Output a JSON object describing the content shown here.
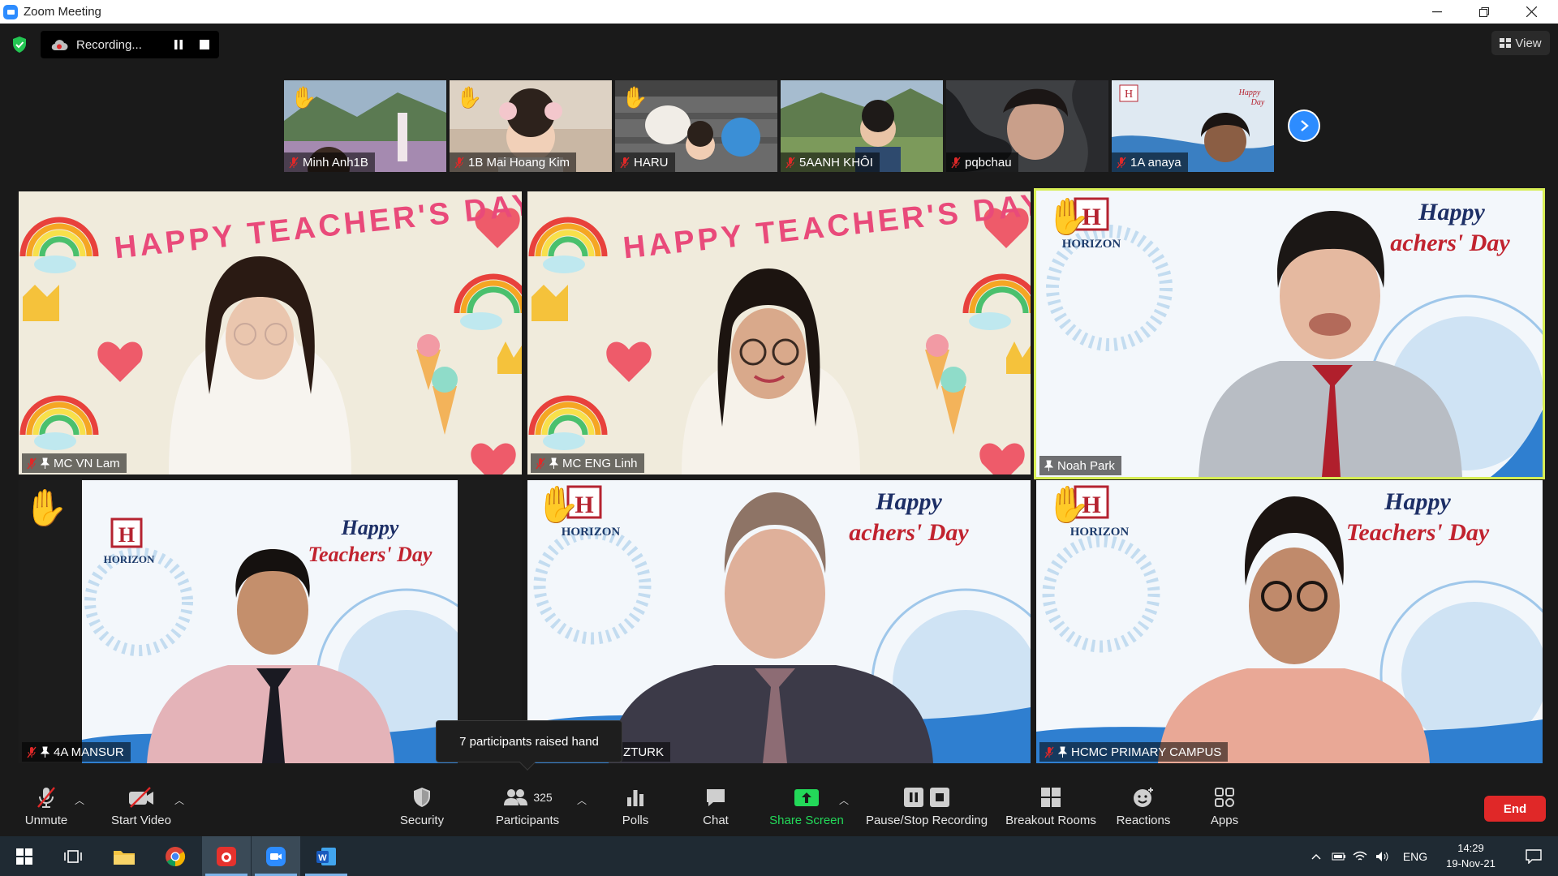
{
  "window": {
    "title": "Zoom Meeting"
  },
  "top": {
    "recording_label": "Recording...",
    "view_label": "View"
  },
  "thumbnails": [
    {
      "name": "Minh Anh1B",
      "hand": true,
      "bg": "#7d9a6a"
    },
    {
      "name": "1B Mai Hoang Kim",
      "hand": true,
      "bg": "#c9b7a4"
    },
    {
      "name": "HARU",
      "hand": true,
      "bg": "#8e8e8e"
    },
    {
      "name": "5AANH KHÔI",
      "hand": false,
      "bg": "#6f8a5d"
    },
    {
      "name": "pqbchau",
      "hand": false,
      "bg": "#4d4f52"
    },
    {
      "name": "1A anaya",
      "hand": false,
      "bg": "#d8e4ef"
    }
  ],
  "tiles": [
    {
      "name": "MC VN Lam",
      "background_text": "HAPPY TEACHER'S DAY",
      "hand": false
    },
    {
      "name": "MC ENG Linh",
      "background_text": "HAPPY TEACHER'S DAY",
      "hand": false
    },
    {
      "name": "Noah Park",
      "hand": true,
      "logo": "HORIZON",
      "banner": "Happy",
      "banner2": "achers' Day"
    },
    {
      "name": "4A MANSUR",
      "hand": true,
      "logo": "HORIZON",
      "banner": "Happy",
      "banner2": "Teachers' Day"
    },
    {
      "name": "ZTURK",
      "hand": true,
      "logo": "HORIZON",
      "banner": "Happy",
      "banner2": "achers' Day"
    },
    {
      "name": "HCMC PRIMARY CAMPUS",
      "hand": true,
      "logo": "HORIZON",
      "banner": "Happy",
      "banner2": "Teachers' Day"
    }
  ],
  "tooltip": {
    "text": "7 participants raised hand"
  },
  "toolbar": {
    "unmute": "Unmute",
    "start_video": "Start Video",
    "security": "Security",
    "participants": "Participants",
    "participants_count": "325",
    "polls": "Polls",
    "chat": "Chat",
    "share_screen": "Share Screen",
    "pause_stop_recording": "Pause/Stop Recording",
    "breakout_rooms": "Breakout Rooms",
    "reactions": "Reactions",
    "apps": "Apps",
    "end": "End"
  },
  "taskbar": {
    "lang": "ENG",
    "time": "14:29",
    "date": "19-Nov-21"
  },
  "colors": {
    "accent": "#2d8cff",
    "share_green": "#23d959",
    "end_red": "#e02828",
    "active_speaker": "#d7ee55"
  }
}
